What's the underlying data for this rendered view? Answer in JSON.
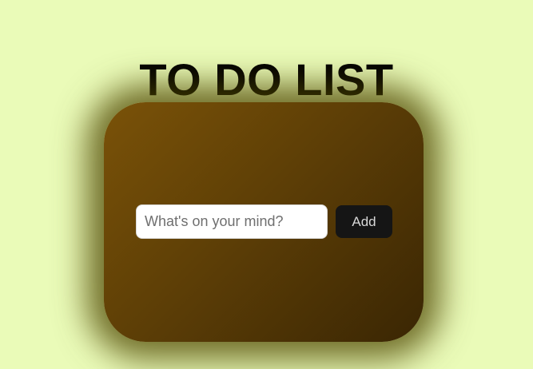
{
  "page": {
    "title": "TO DO LIST"
  },
  "todo_form": {
    "input_placeholder": "What's on your mind?",
    "input_value": "",
    "add_label": "Add"
  },
  "colors": {
    "background": "#eafbb8",
    "card_gradient_start": "#7a5208",
    "card_gradient_end": "#3a2604",
    "button": "#151515"
  }
}
